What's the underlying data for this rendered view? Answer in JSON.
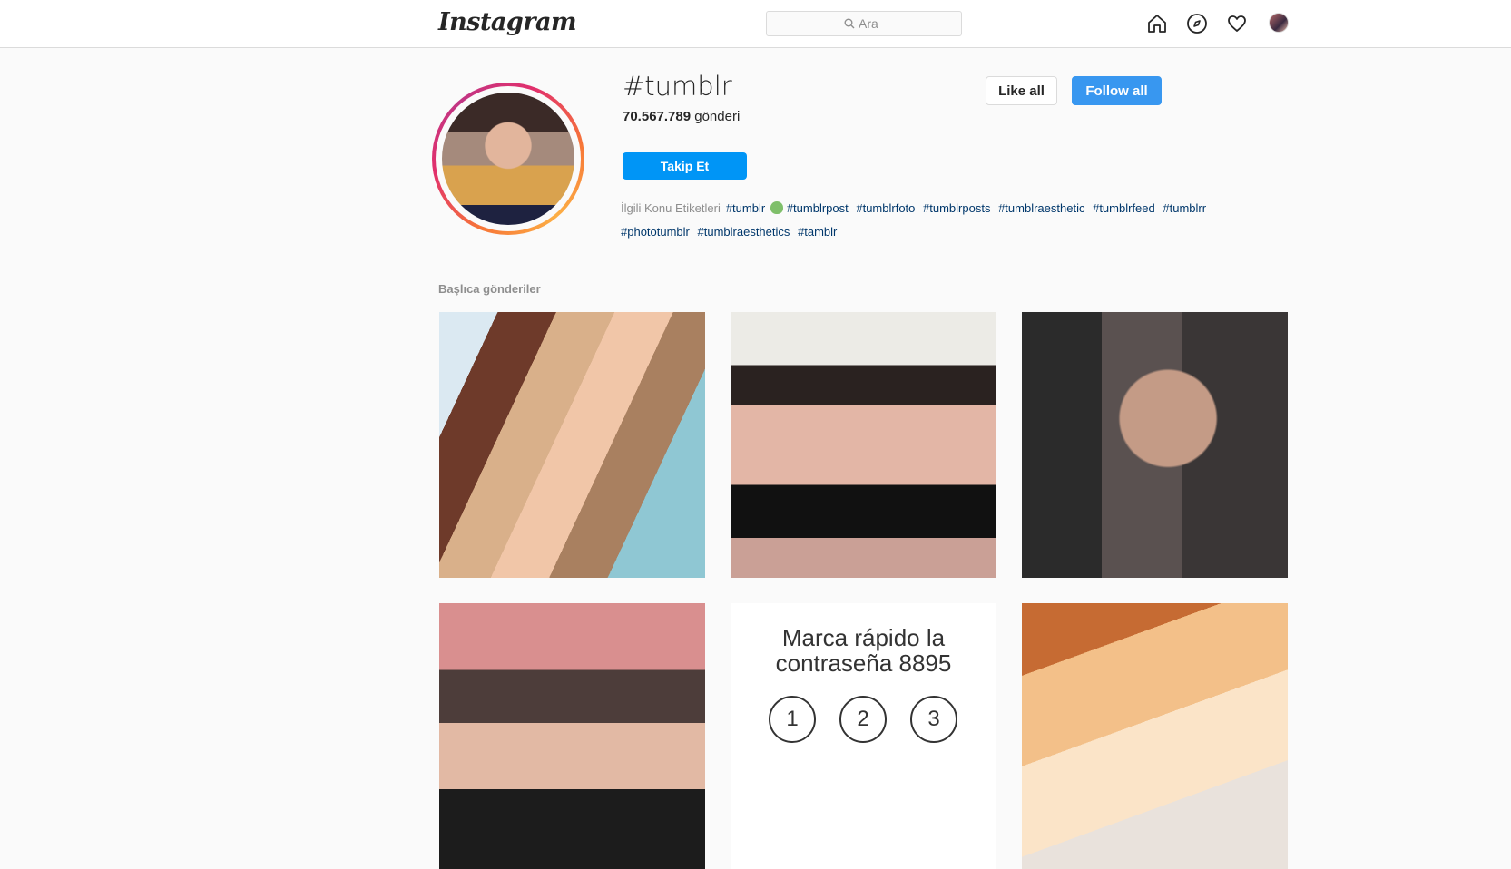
{
  "header": {
    "logo": "Instagram",
    "search_placeholder": "Ara",
    "icons": [
      "home-icon",
      "explore-icon",
      "heart-icon",
      "profile-avatar"
    ]
  },
  "hashtag": {
    "title": "#tumblr",
    "post_count": "70.567.789",
    "post_count_suffix": "gönderi",
    "follow_label": "Takip Et",
    "like_all_label": "Like all",
    "follow_all_label": "Follow all"
  },
  "related": {
    "label": "İlgili Konu Etiketleri",
    "tags": [
      "#tumblr",
      "#tumblrpost",
      "#tumblrfoto",
      "#tumblrposts",
      "#tumblraesthetic",
      "#tumblrfeed",
      "#tumblrr",
      "#phototumblr",
      "#tumblraesthetics",
      "#tamblr"
    ]
  },
  "section": {
    "top_posts_title": "Başlıca gönderiler"
  },
  "posts": {
    "p5_caption_line1": "Marca rápido la",
    "p5_caption_line2": "contraseña 8895",
    "p5_digits": [
      "1",
      "2",
      "3"
    ]
  },
  "colors": {
    "primary_blue": "#0095f6",
    "follow_all_blue": "#3897f0",
    "link": "#00376b",
    "muted": "#8e8e8e"
  }
}
